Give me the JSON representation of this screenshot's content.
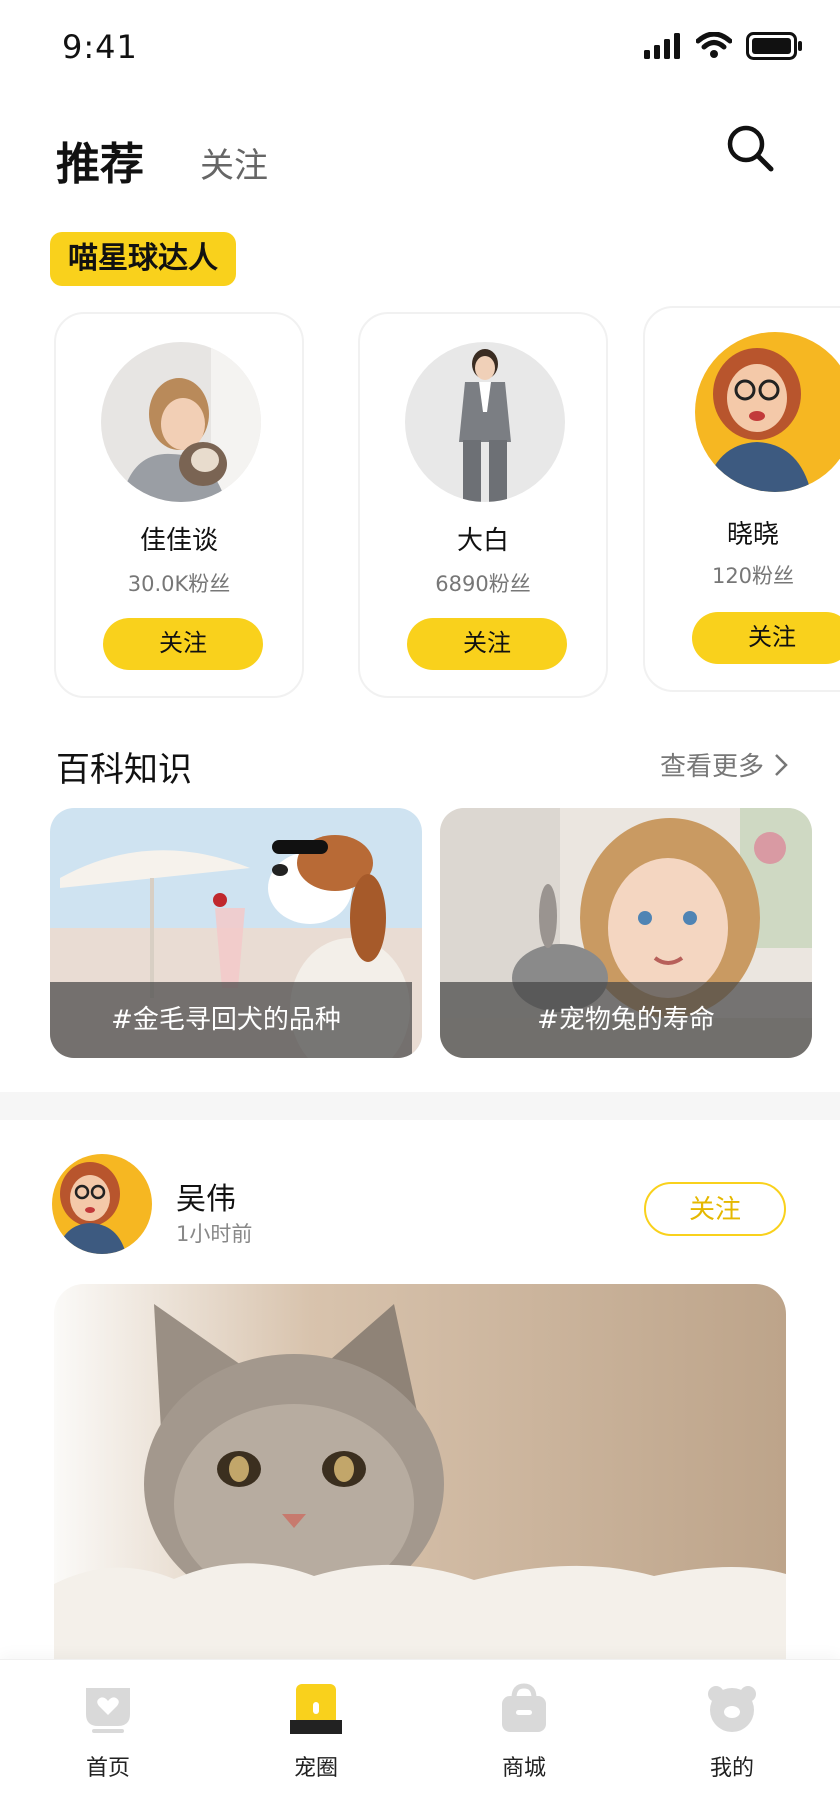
{
  "status_bar": {
    "time": "9:41",
    "icons": [
      "signal-icon",
      "wifi-icon",
      "battery-icon"
    ]
  },
  "header": {
    "tab_active": "推荐",
    "tab_inactive": "关注",
    "search_icon": "search-icon"
  },
  "influencers": {
    "badge": "喵星球达人",
    "items": [
      {
        "name": "佳佳谈",
        "fans": "30.0K粉丝",
        "follow": "关注"
      },
      {
        "name": "大白",
        "fans": "6890粉丝",
        "follow": "关注"
      },
      {
        "name": "晓晓",
        "fans": "120粉丝",
        "follow": "关注"
      }
    ]
  },
  "encyclopedia": {
    "title": "百科知识",
    "more": "查看更多",
    "cards": [
      {
        "caption": "#金毛寻回犬的品种"
      },
      {
        "caption": "#宠物兔的寿命"
      }
    ]
  },
  "post": {
    "author": "吴伟",
    "time": "1小时前",
    "follow": "关注"
  },
  "tabbar": {
    "items": [
      {
        "label": "首页",
        "icon": "home-icon"
      },
      {
        "label": "宠圈",
        "icon": "pet-circle-icon"
      },
      {
        "label": "商城",
        "icon": "shop-bag-icon"
      },
      {
        "label": "我的",
        "icon": "profile-bear-icon"
      }
    ]
  },
  "colors": {
    "accent": "#f9d11c",
    "text": "#111111",
    "muted": "#777777"
  }
}
